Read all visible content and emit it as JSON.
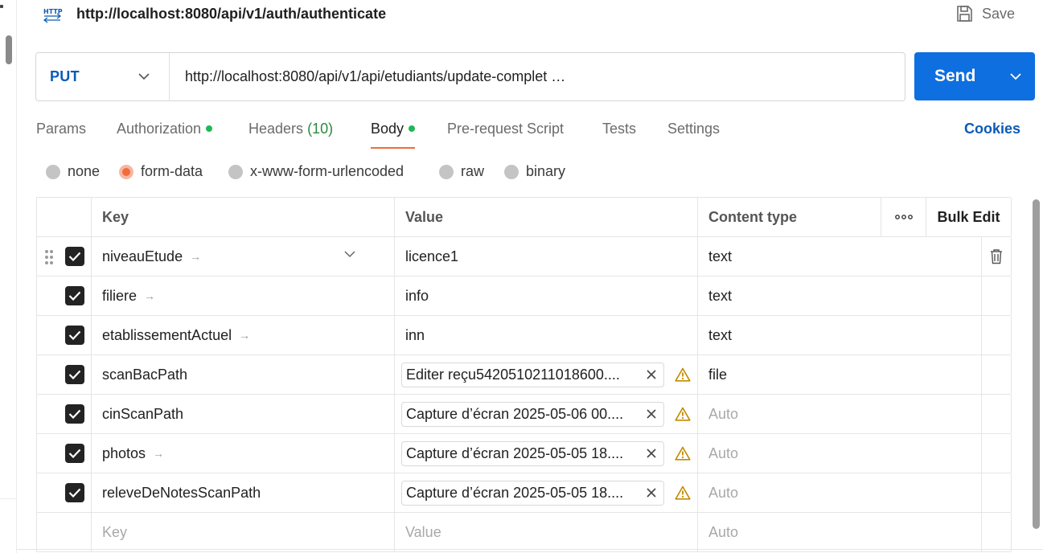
{
  "header": {
    "title": "http://localhost:8080/api/v1/auth/authenticate",
    "icon": "http-icon",
    "save_label": "Save"
  },
  "request": {
    "method": "PUT",
    "url": "http://localhost:8080/api/v1/api/etudiants/update-complet …",
    "send_label": "Send"
  },
  "tabs": [
    {
      "label": "Params",
      "active": false
    },
    {
      "label": "Authorization",
      "active": false,
      "dot": true
    },
    {
      "label": "Headers",
      "count": "(10)",
      "active": false
    },
    {
      "label": "Body",
      "active": true,
      "dot": true
    },
    {
      "label": "Pre-request Script",
      "active": false
    },
    {
      "label": "Tests",
      "active": false
    },
    {
      "label": "Settings",
      "active": false
    }
  ],
  "cookies_label": "Cookies",
  "body_types": [
    {
      "label": "none",
      "selected": false
    },
    {
      "label": "form-data",
      "selected": true
    },
    {
      "label": "x-www-form-urlencoded",
      "selected": false
    },
    {
      "label": "raw",
      "selected": false
    },
    {
      "label": "binary",
      "selected": false
    }
  ],
  "table": {
    "headers": {
      "key": "Key",
      "value": "Value",
      "content_type": "Content type",
      "more": "•••",
      "bulk_edit": "Bulk Edit"
    },
    "rows": [
      {
        "key": "niveauEtude",
        "value": "licence1",
        "content_type": "text",
        "checked": true
      },
      {
        "key": "filiere",
        "value": "info",
        "content_type": "text",
        "checked": true
      },
      {
        "key": "etablissementActuel",
        "value": "inn",
        "content_type": "text",
        "checked": true
      },
      {
        "key": "scanBacPath",
        "file": "Editer reçu5420510211018600....",
        "content_type": "file",
        "checked": true
      },
      {
        "key": "cinScanPath",
        "file": "Capture d’écran 2025-05-06 00....",
        "content_type": "Auto",
        "checked": true
      },
      {
        "key": "photos",
        "file": "Capture d’écran 2025-05-05 18....",
        "content_type": "Auto",
        "checked": true
      },
      {
        "key": "releveDeNotesScanPath",
        "file": "Capture d’écran 2025-05-05 18....",
        "content_type": "Auto",
        "checked": true
      }
    ],
    "new_row": {
      "key_placeholder": "Key",
      "value_placeholder": "Value",
      "content_type_placeholder": "Auto"
    }
  },
  "colors": {
    "accent": "#0d6fe0",
    "active_tab": "#f26b3a",
    "status_dot": "#1db954",
    "warning": "#c28a00"
  }
}
